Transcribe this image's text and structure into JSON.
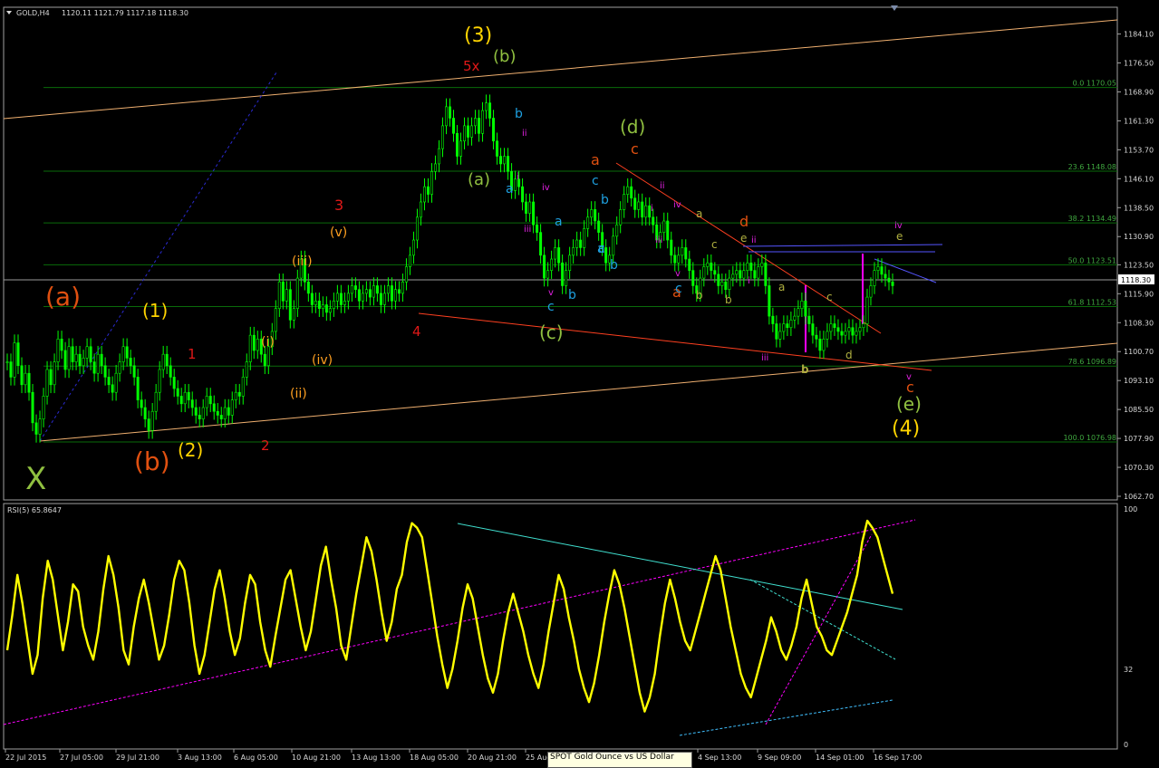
{
  "header": {
    "symbol": "GOLD,H4",
    "ohlc": "1120.11 1121.79 1117.18 1118.30"
  },
  "rsi_header": "RSI(5) 65.8647",
  "tooltip": {
    "line1": "SPOT Gold Ounce vs US Dollar"
  },
  "colors": {
    "background": "#000000",
    "candle": "#00ff00",
    "rsi": "#ffff00",
    "grid": "#006400"
  },
  "chart_data": [
    {
      "type": "candlestick",
      "symbol": "GOLD",
      "timeframe": "H4",
      "current_price": "1118.30",
      "ylim": [
        1062.7,
        1187.8
      ],
      "price_axis_ticks": [
        "1184.10",
        "1176.50",
        "1168.90",
        "1161.30",
        "1153.70",
        "1146.10",
        "1138.50",
        "1130.90",
        "1123.50",
        "1115.90",
        "1108.30",
        "1100.70",
        "1093.10",
        "1085.50",
        "1077.90",
        "1070.30",
        "1062.70"
      ],
      "time_axis_ticks": [
        "22 Jul 2015",
        "27 Jul 05:00",
        "29 Jul 21:00",
        "3 Aug 13:00",
        "6 Aug 05:00",
        "10 Aug 21:00",
        "13 Aug 13:00",
        "18 Aug 05:00",
        "20 Aug 21:00",
        "25 Aug",
        "4 Sep 13:00",
        "9 Sep 09:00",
        "14 Sep 01:00",
        "16 Sep 17:00"
      ],
      "fibonacci_levels": [
        {
          "label": "0.0 1170.05",
          "value": 1170.05
        },
        {
          "label": "23.6 1148.08",
          "value": 1148.08
        },
        {
          "label": "38.2 1134.49",
          "value": 1134.49
        },
        {
          "label": "50.0 1123.51",
          "value": 1123.51
        },
        {
          "label": "61.8 1112.53",
          "value": 1112.53
        },
        {
          "label": "78.6 1096.89",
          "value": 1096.89
        },
        {
          "label": "100.0 1076.98",
          "value": 1076.98
        }
      ],
      "price_path": [
        1098,
        1094,
        1103,
        1097,
        1092,
        1095,
        1090,
        1082,
        1079,
        1083,
        1089,
        1096,
        1092,
        1098,
        1104,
        1101,
        1096,
        1102,
        1098,
        1100,
        1097,
        1099,
        1102,
        1098,
        1095,
        1100,
        1097,
        1094,
        1092,
        1090,
        1095,
        1098,
        1102,
        1099,
        1097,
        1094,
        1088,
        1086,
        1083,
        1080,
        1085,
        1090,
        1096,
        1100,
        1097,
        1094,
        1091,
        1089,
        1087,
        1090,
        1088,
        1086,
        1084,
        1083,
        1086,
        1089,
        1087,
        1085,
        1084,
        1083,
        1086,
        1084,
        1088,
        1090,
        1089,
        1094,
        1098,
        1105,
        1101,
        1104,
        1100,
        1097,
        1102,
        1106,
        1112,
        1119,
        1114,
        1117,
        1109,
        1112,
        1120,
        1125,
        1119,
        1116,
        1113,
        1114,
        1112,
        1113,
        1111,
        1112,
        1114,
        1116,
        1113,
        1114,
        1116,
        1118,
        1117,
        1114,
        1116,
        1117,
        1115,
        1118,
        1116,
        1113,
        1116,
        1118,
        1114,
        1117,
        1116,
        1119,
        1123,
        1126,
        1130,
        1136,
        1140,
        1144,
        1142,
        1148,
        1150,
        1154,
        1160,
        1165,
        1162,
        1158,
        1152,
        1156,
        1160,
        1157,
        1160,
        1162,
        1158,
        1164,
        1166,
        1162,
        1156,
        1152,
        1150,
        1152,
        1148,
        1143,
        1146,
        1144,
        1140,
        1137,
        1140,
        1134,
        1132,
        1126,
        1120,
        1122,
        1125,
        1128,
        1124,
        1118,
        1122,
        1126,
        1128,
        1130,
        1128,
        1133,
        1136,
        1138,
        1135,
        1132,
        1128,
        1124,
        1126,
        1131,
        1134,
        1138,
        1142,
        1144,
        1141,
        1138,
        1140,
        1136,
        1139,
        1136,
        1134,
        1130,
        1132,
        1135,
        1130,
        1126,
        1124,
        1126,
        1128,
        1125,
        1122,
        1118,
        1116,
        1120,
        1123,
        1124,
        1122,
        1121,
        1118,
        1119,
        1117,
        1120,
        1121,
        1122,
        1120,
        1122,
        1124,
        1122,
        1120,
        1123,
        1124,
        1118,
        1110,
        1108,
        1104,
        1106,
        1108,
        1107,
        1109,
        1110,
        1112,
        1114,
        1110,
        1108,
        1105,
        1104,
        1101,
        1104,
        1106,
        1108,
        1107,
        1106,
        1105,
        1106,
        1107,
        1105,
        1106,
        1107,
        1108,
        1115,
        1118,
        1122,
        1123,
        1121,
        1120,
        1119,
        1118
      ],
      "wave_labels": [
        "(3)",
        "5x",
        "(b)",
        "(a)",
        "b",
        "a",
        "ii",
        "i",
        "iv",
        "iii",
        "v",
        "c",
        "b",
        "(c)",
        "(d)",
        "c",
        "a",
        "c",
        "b",
        "a",
        "c",
        "b",
        "a",
        "ii",
        "i",
        "iv",
        "iii",
        "a",
        "v",
        "c",
        "a",
        "b",
        "c",
        "b",
        "d",
        "b",
        "e",
        "ii",
        "i",
        "iv",
        "e",
        "iii",
        "b",
        "a",
        "c",
        "d",
        "v",
        "c",
        "(e)",
        "(4)",
        "(a)",
        "(1)",
        "1",
        "(b)",
        "(2)",
        "2",
        "X",
        "3",
        "(v)",
        "(iii)",
        "(i)",
        "(iv)",
        "(ii)",
        "4"
      ]
    },
    {
      "type": "line",
      "indicator": "RSI(5)",
      "value": "65.8647",
      "ylim": [
        0,
        100
      ],
      "ticks": [
        "100",
        "32",
        "0"
      ],
      "values": [
        40,
        55,
        72,
        60,
        45,
        30,
        38,
        62,
        78,
        70,
        55,
        40,
        52,
        68,
        65,
        50,
        42,
        36,
        48,
        66,
        80,
        72,
        58,
        40,
        34,
        50,
        62,
        70,
        60,
        48,
        36,
        42,
        55,
        70,
        78,
        74,
        60,
        42,
        30,
        38,
        52,
        66,
        74,
        62,
        48,
        38,
        45,
        60,
        72,
        68,
        52,
        40,
        33,
        46,
        58,
        70,
        74,
        62,
        50,
        40,
        48,
        62,
        76,
        84,
        70,
        58,
        42,
        36,
        50,
        64,
        76,
        88,
        82,
        70,
        56,
        44,
        52,
        66,
        72,
        86,
        94,
        92,
        88,
        74,
        60,
        46,
        34,
        24,
        32,
        44,
        58,
        68,
        62,
        50,
        38,
        28,
        22,
        30,
        44,
        56,
        64,
        56,
        48,
        38,
        30,
        24,
        34,
        48,
        60,
        72,
        66,
        54,
        44,
        32,
        24,
        18,
        26,
        38,
        52,
        64,
        74,
        68,
        58,
        46,
        34,
        22,
        14,
        20,
        30,
        46,
        60,
        70,
        62,
        52,
        44,
        40,
        48,
        56,
        64,
        72,
        80,
        74,
        62,
        50,
        40,
        30,
        24,
        20,
        28,
        36,
        44,
        54,
        48,
        40,
        36,
        42,
        50,
        62,
        70,
        60,
        50,
        46,
        40,
        38,
        44,
        50,
        56,
        64,
        72,
        86,
        95,
        92,
        88,
        80,
        72,
        64
      ]
    }
  ]
}
